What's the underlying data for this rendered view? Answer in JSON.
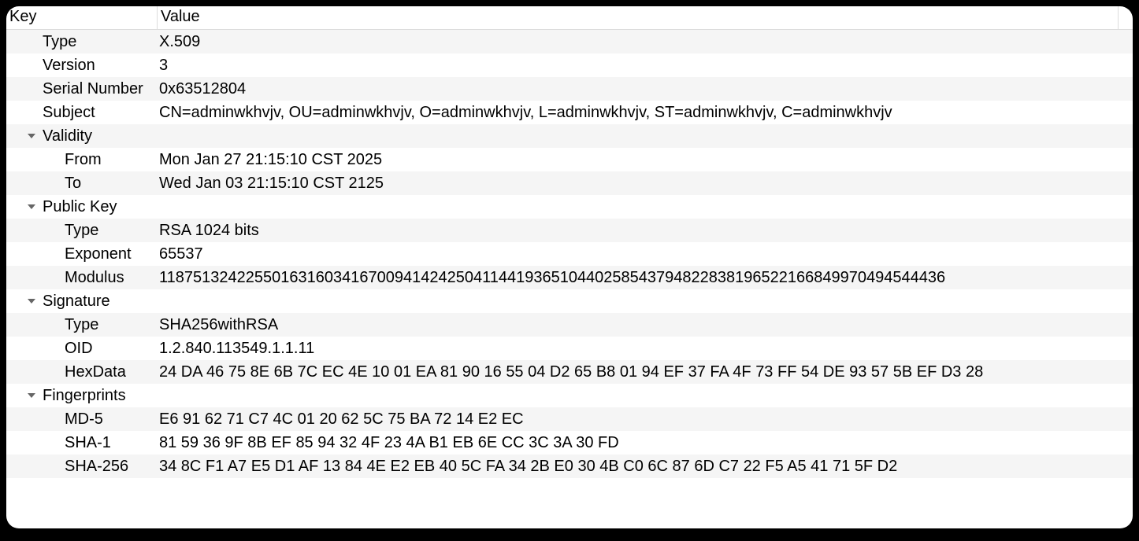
{
  "header": {
    "key_label": "Key",
    "value_label": "Value"
  },
  "rows": [
    {
      "indent": 1,
      "key": "Type",
      "value": "X.509",
      "expandable": false
    },
    {
      "indent": 1,
      "key": "Version",
      "value": "3",
      "expandable": false
    },
    {
      "indent": 1,
      "key": "Serial Number",
      "value": "0x63512804",
      "expandable": false
    },
    {
      "indent": 1,
      "key": "Subject",
      "value": "CN=adminwkhvjv, OU=adminwkhvjv, O=adminwkhvjv, L=adminwkhvjv, ST=adminwkhvjv, C=adminwkhvjv",
      "expandable": false
    },
    {
      "indent": 1,
      "key": "Validity",
      "value": "",
      "expandable": true
    },
    {
      "indent": 2,
      "key": "From",
      "value": "Mon Jan 27 21:15:10 CST 2025",
      "expandable": false
    },
    {
      "indent": 2,
      "key": "To",
      "value": "Wed Jan 03 21:15:10 CST 2125",
      "expandable": false
    },
    {
      "indent": 1,
      "key": "Public Key",
      "value": "",
      "expandable": true
    },
    {
      "indent": 2,
      "key": "Type",
      "value": "RSA 1024 bits",
      "expandable": false
    },
    {
      "indent": 2,
      "key": "Exponent",
      "value": "65537",
      "expandable": false
    },
    {
      "indent": 2,
      "key": "Modulus",
      "value": "118751324225501631603416700941424250411441936510440258543794822838196522166849970494544436",
      "expandable": false
    },
    {
      "indent": 1,
      "key": "Signature",
      "value": "",
      "expandable": true
    },
    {
      "indent": 2,
      "key": "Type",
      "value": "SHA256withRSA",
      "expandable": false
    },
    {
      "indent": 2,
      "key": "OID",
      "value": "1.2.840.113549.1.1.11",
      "expandable": false
    },
    {
      "indent": 2,
      "key": "HexData",
      "value": "24 DA 46 75 8E 6B 7C EC 4E 10 01 EA 81 90 16 55 04 D2 65 B8 01 94 EF 37 FA 4F 73 FF 54 DE 93 57 5B EF D3 28",
      "expandable": false
    },
    {
      "indent": 1,
      "key": "Fingerprints",
      "value": "",
      "expandable": true
    },
    {
      "indent": 2,
      "key": "MD-5",
      "value": "E6 91 62 71 C7 4C 01 20 62 5C 75 BA 72 14 E2 EC",
      "expandable": false
    },
    {
      "indent": 2,
      "key": "SHA-1",
      "value": "81 59 36 9F 8B EF 85 94 32 4F 23 4A B1 EB 6E CC 3C 3A 30 FD",
      "expandable": false
    },
    {
      "indent": 2,
      "key": "SHA-256",
      "value": "34 8C F1 A7 E5 D1 AF 13 84 4E E2 EB 40 5C FA 34 2B E0 30 4B C0 6C 87 6D C7 22 F5 A5 41 71 5F D2",
      "expandable": false
    },
    {
      "indent": 1,
      "key": "",
      "value": "",
      "expandable": false
    }
  ]
}
